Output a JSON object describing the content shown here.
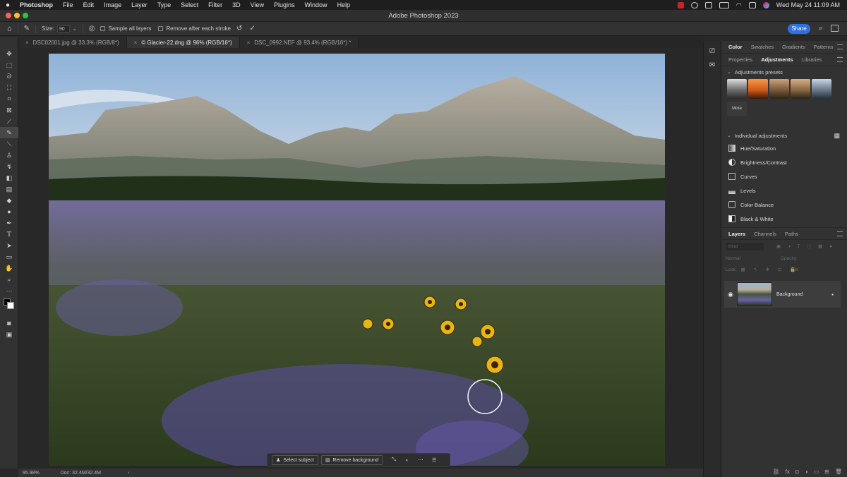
{
  "menubar": {
    "app_name": "Photoshop",
    "items": [
      "File",
      "Edit",
      "Image",
      "Layer",
      "Type",
      "Select",
      "Filter",
      "3D",
      "View",
      "Plugins",
      "Window",
      "Help"
    ],
    "clock": "Wed May 24  11:09 AM"
  },
  "window": {
    "title": "Adobe Photoshop 2023"
  },
  "options": {
    "size_label": "Size:",
    "size_value": "90",
    "sample_all_layers": "Sample all layers",
    "remove_after_stroke": "Remove after each stroke",
    "share_label": "Share"
  },
  "tabs": [
    {
      "label": "DSC02001.jpg @ 33.3% (RGB/8*)"
    },
    {
      "label": "© Glacier-22.dng @ 96% (RGB/16*)"
    },
    {
      "label": "DSC_0992.NEF @ 93.4% (RGB/16*) *"
    }
  ],
  "status": {
    "zoom": "95.98%",
    "doc": "Doc: 32.4M/32.4M"
  },
  "taskbar": {
    "select_subject": "Select subject",
    "remove_background": "Remove background"
  },
  "panels": {
    "top_tabs": [
      "Color",
      "Swatches",
      "Gradients",
      "Patterns"
    ],
    "mid_tabs": [
      "Properties",
      "Adjustments",
      "Libraries"
    ],
    "presets_header": "Adjustments presets",
    "more_label": "More",
    "individual_header": "Individual adjustments",
    "adjustments": [
      "Hue/Saturation",
      "Brightness/Contrast",
      "Curves",
      "Levels",
      "Color Balance",
      "Black & White"
    ],
    "layer_tabs": [
      "Layers",
      "Channels",
      "Paths"
    ],
    "kind_label": "Kind",
    "blend_mode": "Normal",
    "opacity_label": "Opacity:",
    "lock_label": "Lock:",
    "fill_label": "Fill:",
    "layer_name": "Background"
  },
  "colors": {
    "accent": "#2f6fe0",
    "panel_bg": "#323232",
    "canvas_bg": "#282828"
  }
}
